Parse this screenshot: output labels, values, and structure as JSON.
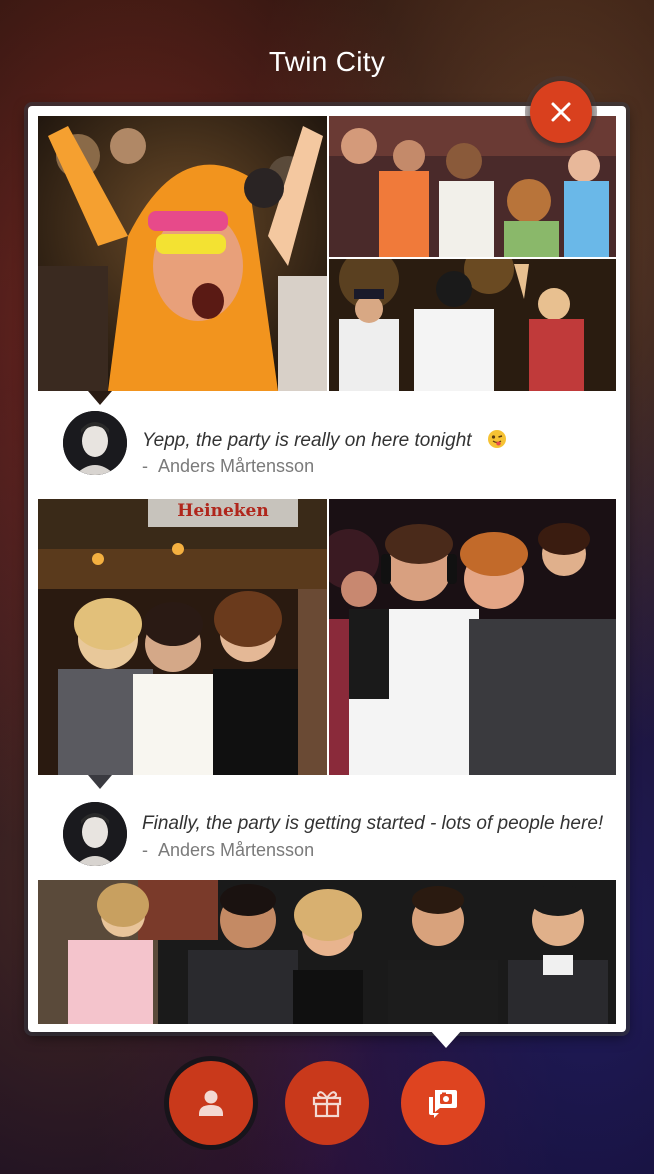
{
  "header": {
    "title": "Twin City"
  },
  "colors": {
    "accent": "#d9401e",
    "card": "#ffffff"
  },
  "feed": {
    "posts": [
      {
        "caption": "Yepp, the party is really on here tonight",
        "caption_emoji": "winking-tongue-face",
        "author": "Anders Mårtensson",
        "author_prefix": "-"
      },
      {
        "caption": "Finally, the party is getting started - lots of people here!",
        "author": "Anders Mårtensson",
        "author_prefix": "-"
      }
    ],
    "photo_signs": {
      "banner": "Heineken"
    }
  },
  "nav": {
    "close": "close-icon",
    "items": [
      {
        "name": "profile",
        "icon": "person-icon"
      },
      {
        "name": "gifts",
        "icon": "gift-icon"
      },
      {
        "name": "photos",
        "icon": "photo-chat-icon",
        "active": true
      }
    ]
  }
}
